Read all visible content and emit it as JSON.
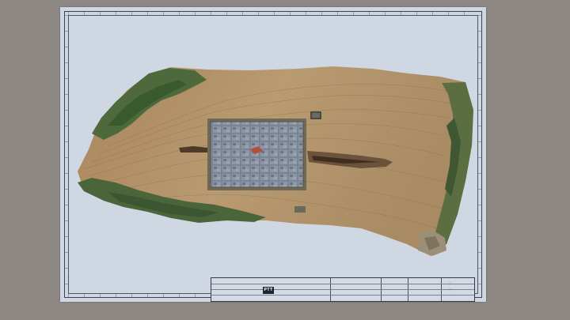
{
  "viewer": {
    "background_color": "#8d8884",
    "sheet_color": "#cfd7e2"
  },
  "title_block": {
    "logo_text": "PTT",
    "lines": [
      "—",
      "—",
      "—",
      "—"
    ]
  },
  "map": {
    "description_only": ""
  }
}
